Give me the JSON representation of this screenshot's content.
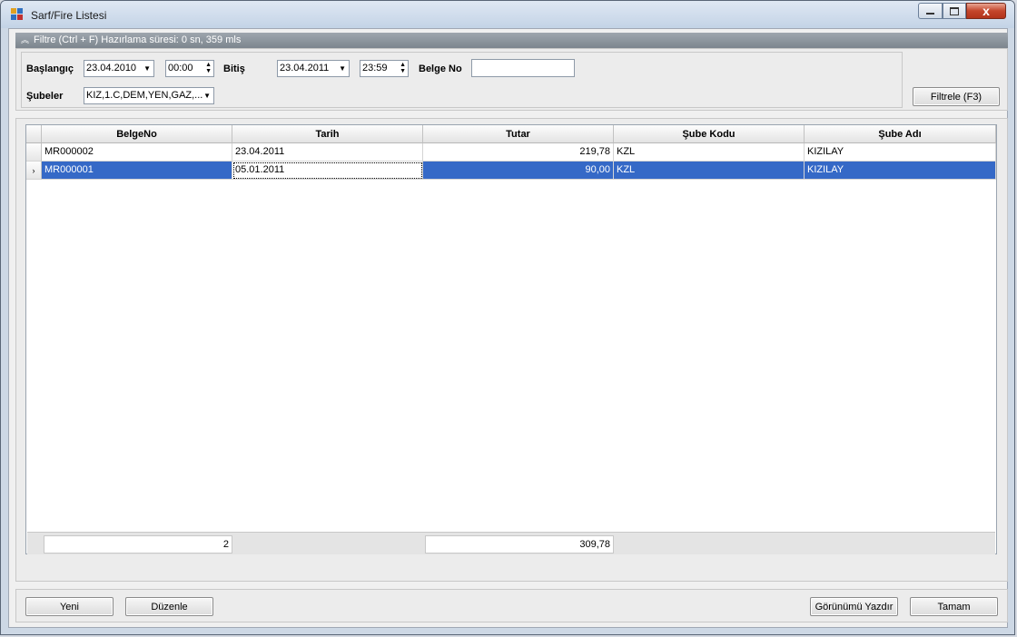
{
  "window": {
    "title": "Sarf/Fire Listesi",
    "close_glyph": "x"
  },
  "filter": {
    "header_text": "Filtre (Ctrl + F) Hazırlama süresi: 0 sn, 359 mls",
    "start_label": "Başlangıç",
    "start_date": "23.04.2010",
    "start_time": "00:00",
    "end_label": "Bitiş",
    "end_date": "23.04.2011",
    "end_time": "23:59",
    "doc_no_label": "Belge No",
    "doc_no_value": "",
    "branches_label": "Şubeler",
    "branches_value": "KIZ,1.C,DEM,YEN,GAZ,...",
    "filter_button": "Filtrele (F3)"
  },
  "grid": {
    "columns": [
      "BelgeNo",
      "Tarih",
      "Tutar",
      "Şube Kodu",
      "Şube Adı"
    ],
    "rows": [
      {
        "belge_no": "MR000002",
        "tarih": "23.04.2011",
        "tutar": "219,78",
        "sube_kodu": "KZL",
        "sube_adi": "KIZILAY",
        "selected": false
      },
      {
        "belge_no": "MR000001",
        "tarih": "05.01.2011",
        "tutar": "90,00",
        "sube_kodu": "KZL",
        "sube_adi": "KIZILAY",
        "selected": true
      }
    ],
    "current_row_marker": "›",
    "footer": {
      "count": "2",
      "total": "309,78"
    }
  },
  "buttons": {
    "new": "Yeni",
    "edit": "Düzenle",
    "print_view": "Görünümü Yazdır",
    "ok": "Tamam"
  },
  "colors": {
    "selection": "#3569c7",
    "filter_header": "#8a929b"
  },
  "icons": [
    "app-icon",
    "minimize-icon",
    "maximize-icon",
    "close-icon",
    "collapse-chevron-icon",
    "dropdown-arrow-icon",
    "spin-icon",
    "row-pointer-icon"
  ]
}
